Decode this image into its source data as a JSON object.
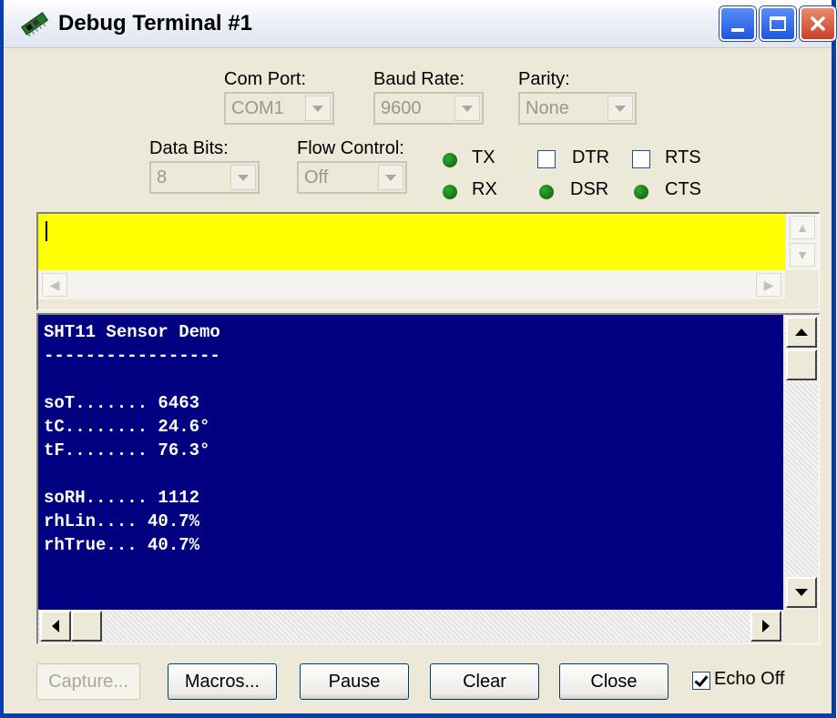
{
  "window": {
    "title": "Debug Terminal #1",
    "icon": "chip-icon"
  },
  "settings": {
    "com_port": {
      "label": "Com Port:",
      "value": "COM1"
    },
    "baud_rate": {
      "label": "Baud Rate:",
      "value": "9600"
    },
    "parity": {
      "label": "Parity:",
      "value": "None"
    },
    "data_bits": {
      "label": "Data Bits:",
      "value": "8"
    },
    "flow_control": {
      "label": "Flow Control:",
      "value": "Off"
    }
  },
  "indicators": {
    "tx": "TX",
    "rx": "RX",
    "dtr": "DTR",
    "rts": "RTS",
    "dsr": "DSR",
    "cts": "CTS",
    "led_color": "#0a7a0a"
  },
  "input": {
    "background": "#ffff00",
    "value": ""
  },
  "terminal": {
    "background": "#000080",
    "lines": [
      "SHT11 Sensor Demo",
      "-----------------",
      "",
      "soT....... 6463",
      "tC........ 24.6°",
      "tF........ 76.3°",
      "",
      "soRH...... 1112",
      "rhLin.... 40.7%",
      "rhTrue... 40.7%"
    ]
  },
  "buttons": {
    "capture": "Capture...",
    "macros": "Macros...",
    "pause": "Pause",
    "clear": "Clear",
    "close": "Close",
    "echo_off": "Echo Off"
  }
}
